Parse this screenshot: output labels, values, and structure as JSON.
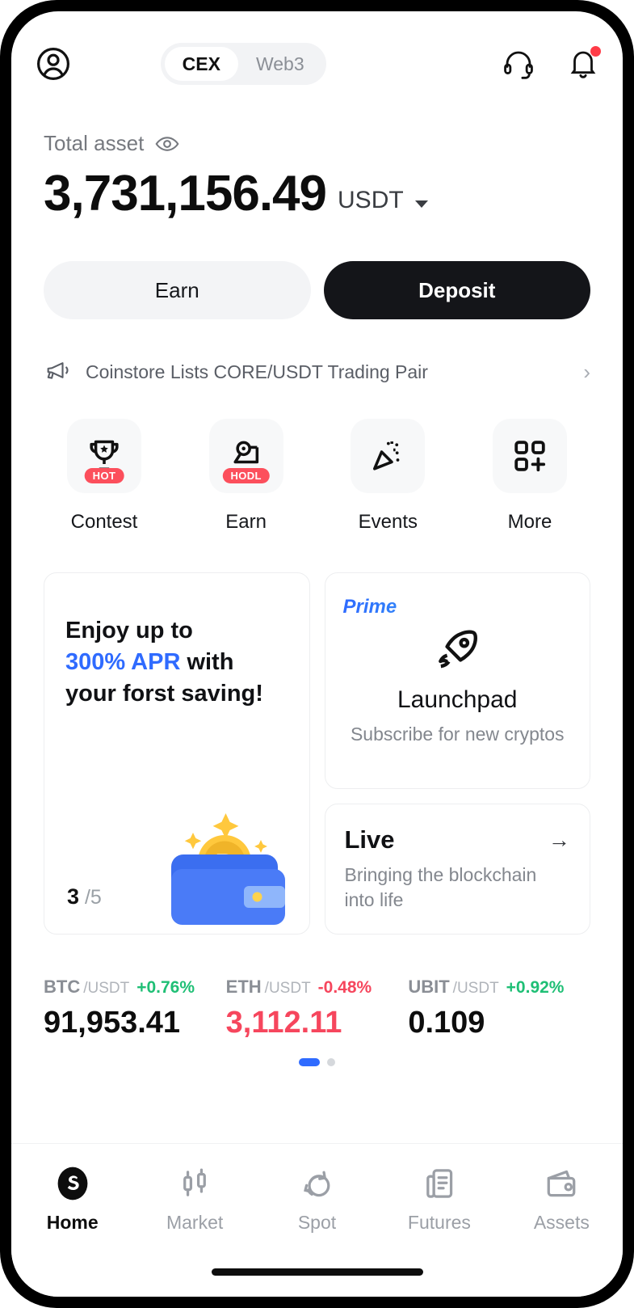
{
  "header": {
    "avatar_icon": "user-circle-icon",
    "tabs": [
      {
        "label": "CEX",
        "active": true
      },
      {
        "label": "Web3",
        "active": false
      }
    ],
    "support_icon": "headset-icon",
    "notification_icon": "bell-icon",
    "notification_dot_color": "#ff3b47"
  },
  "balance": {
    "label": "Total asset",
    "eye_icon": "eye-icon",
    "amount": "3,731,156.49",
    "currency": "USDT",
    "caret_icon": "chevron-down-icon"
  },
  "actions": {
    "earn_label": "Earn",
    "deposit_label": "Deposit"
  },
  "announcement": {
    "icon": "megaphone-icon",
    "text": "Coinstore Lists CORE/USDT Trading Pair",
    "chevron": "›"
  },
  "quick_actions": [
    {
      "label": "Contest",
      "icon": "trophy-icon",
      "badge": "HOT"
    },
    {
      "label": "Earn",
      "icon": "hodl-coin-icon",
      "badge": "HODL"
    },
    {
      "label": "Events",
      "icon": "party-popper-icon",
      "badge": ""
    },
    {
      "label": "More",
      "icon": "grid-plus-icon",
      "badge": ""
    }
  ],
  "earn_card": {
    "line1": "Enjoy up to",
    "highlight": "300% APR",
    "line2_rest": " with",
    "line3": "your forst saving!",
    "highlight_color": "#2f6bff",
    "page_current": "3",
    "page_total": "/5",
    "art_icon": "wallet-bitcoin-icon"
  },
  "prime_card": {
    "tag": "Prime",
    "icon": "rocket-icon",
    "title": "Launchpad",
    "subtitle": "Subscribe for new cryptos"
  },
  "live_card": {
    "title": "Live",
    "arrow_icon": "arrow-right-icon",
    "subtitle": "Bringing the blockchain into life"
  },
  "tickers": [
    {
      "base": "BTC",
      "quote": "/USDT",
      "change": "+0.76%",
      "price": "91,953.41",
      "direction": "up"
    },
    {
      "base": "ETH",
      "quote": "/USDT",
      "change": "-0.48%",
      "price": "3,112.11",
      "direction": "down"
    },
    {
      "base": "UBIT",
      "quote": "/USDT",
      "change": "+0.92%",
      "price": "0.109",
      "direction": "up"
    }
  ],
  "ticker_pagination": {
    "active_index": 0,
    "count": 2,
    "active_color": "#2f6bff"
  },
  "bottom_nav": [
    {
      "label": "Home",
      "icon": "home-logo-icon",
      "active": true
    },
    {
      "label": "Market",
      "icon": "candlestick-icon",
      "active": false
    },
    {
      "label": "Spot",
      "icon": "swap-circle-icon",
      "active": false
    },
    {
      "label": "Futures",
      "icon": "futures-doc-icon",
      "active": false
    },
    {
      "label": "Assets",
      "icon": "wallet-icon",
      "active": false
    }
  ],
  "colors": {
    "up": "#1fbf75",
    "down": "#f6465d",
    "accent": "#2f6bff",
    "badge": "#fc4f5c"
  }
}
